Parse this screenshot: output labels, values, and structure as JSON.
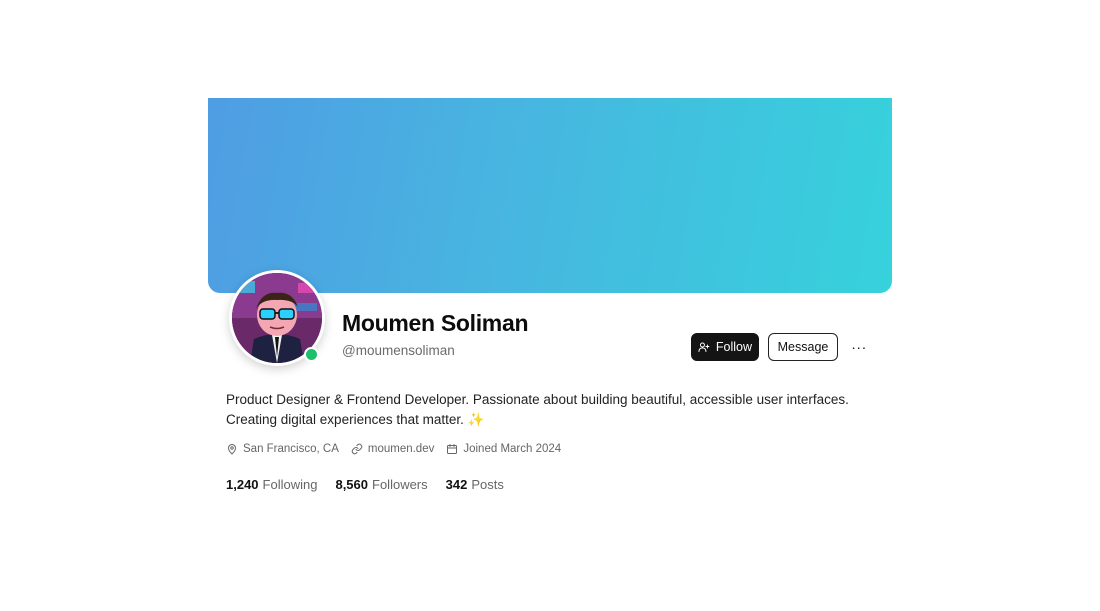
{
  "profile": {
    "name": "Moumen Soliman",
    "handle": "@moumensoliman",
    "bio": "Product Designer & Frontend Developer. Passionate about building beautiful, accessible user interfaces. Creating digital experiences that matter. ✨",
    "status": "online"
  },
  "actions": {
    "follow_label": "Follow",
    "message_label": "Message",
    "more_label": "···"
  },
  "meta": {
    "location": "San Francisco, CA",
    "website": "moumen.dev",
    "joined": "Joined March 2024"
  },
  "stats": [
    {
      "value": "1,240",
      "label": "Following"
    },
    {
      "value": "8,560",
      "label": "Followers"
    },
    {
      "value": "342",
      "label": "Posts"
    }
  ],
  "colors": {
    "cover_start": "#4f9de3",
    "cover_end": "#36d2dc",
    "online": "#1fbe6b",
    "primary_button": "#141414"
  },
  "icons": {
    "follow": "user-plus-icon",
    "location": "map-pin-icon",
    "website": "link-icon",
    "joined": "calendar-icon",
    "more": "more-horizontal-icon"
  }
}
